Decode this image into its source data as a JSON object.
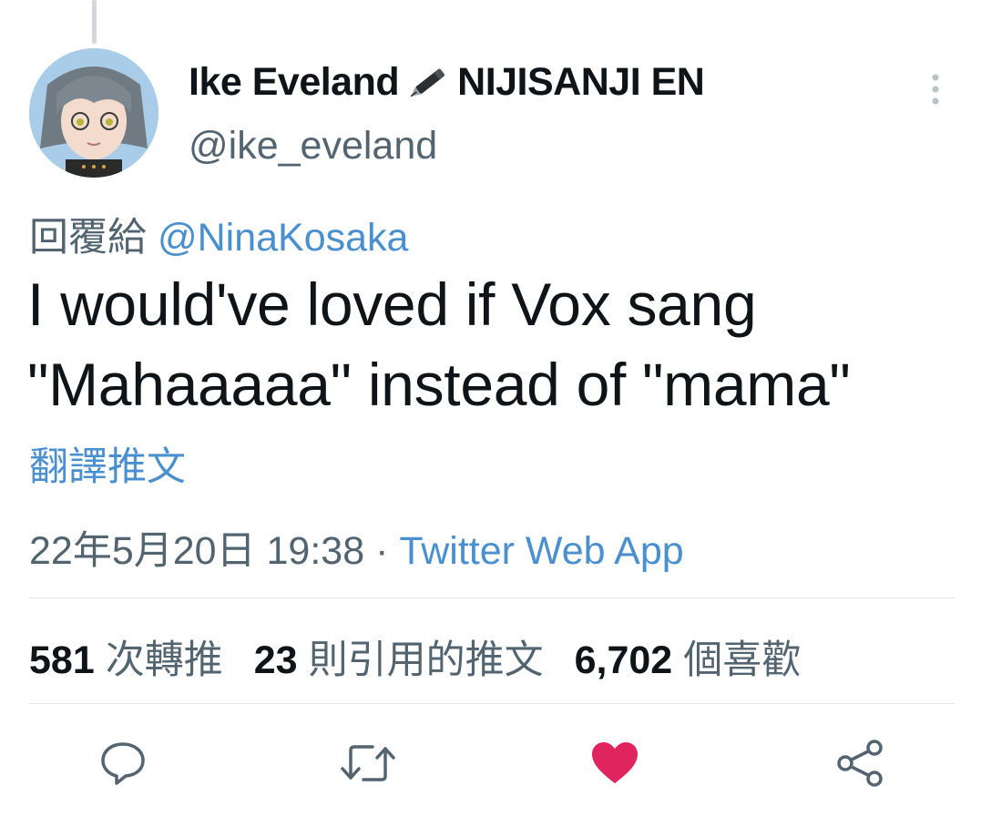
{
  "user": {
    "display_name": "Ike Eveland",
    "display_name_suffix": "NIJISANJI EN",
    "emoji": "pen-icon",
    "handle": "@ike_eveland"
  },
  "reply": {
    "label": "回覆給",
    "mention": "@NinaKosaka"
  },
  "tweet": {
    "line1": "I would've loved if Vox sang",
    "line2": "\"Mahaaaaa\" instead of \"mama\"",
    "translate_label": "翻譯推文"
  },
  "meta": {
    "datetime": "22年5月20日 19:38",
    "separator": "·",
    "source": "Twitter Web App"
  },
  "stats": {
    "retweets_count": "581",
    "retweets_label": "次轉推",
    "quotes_count": "23",
    "quotes_label": "則引用的推文",
    "likes_count": "6,702",
    "likes_label": "個喜歡"
  },
  "actions": {
    "reply_icon": "comment-icon",
    "retweet_icon": "retweet-icon",
    "like_icon": "heart-icon",
    "share_icon": "share-icon",
    "like_active_color": "#e0245e",
    "icon_color": "#536471"
  },
  "colors": {
    "link": "#4a90cf",
    "text": "#0f1419",
    "secondary": "#536471"
  }
}
